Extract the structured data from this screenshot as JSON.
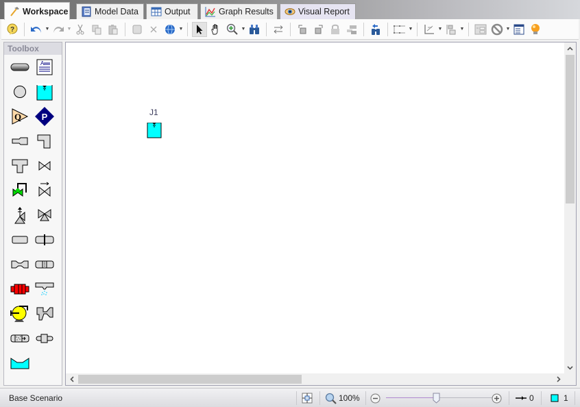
{
  "tabs": [
    {
      "label": "Workspace",
      "icon": "hammer-icon",
      "active": true
    },
    {
      "label": "Model Data",
      "icon": "notebook-icon",
      "active": false
    },
    {
      "label": "Output",
      "icon": "table-grid-icon",
      "active": false
    },
    {
      "label": "Graph Results",
      "icon": "graph-icon",
      "active": false
    },
    {
      "label": "Visual Report",
      "icon": "eye-icon",
      "active": false
    }
  ],
  "toolbar": {
    "items": [
      {
        "name": "help",
        "icon": "help-icon"
      },
      {
        "name": "undo",
        "icon": "undo-icon"
      },
      {
        "name": "redo",
        "icon": "redo-icon",
        "disabled": true
      },
      {
        "name": "cut",
        "icon": "scissors-icon",
        "disabled": true
      },
      {
        "name": "copy",
        "icon": "copy-icon",
        "disabled": true
      },
      {
        "name": "paste",
        "icon": "paste-icon",
        "disabled": true
      },
      {
        "name": "group",
        "icon": "group-icon",
        "disabled": true
      },
      {
        "name": "delete",
        "icon": "delete-x-icon",
        "disabled": true
      },
      {
        "name": "globe",
        "icon": "globe-icon"
      },
      {
        "name": "select",
        "icon": "pointer-arrow-icon",
        "selected": true
      },
      {
        "name": "pan",
        "icon": "hand-icon"
      },
      {
        "name": "zoom",
        "icon": "zoom-in-icon"
      },
      {
        "name": "find",
        "icon": "binoculars-icon"
      },
      {
        "name": "reverse",
        "icon": "reverse-direction-icon"
      },
      {
        "name": "rotate-left",
        "icon": "rotate-left-icon"
      },
      {
        "name": "rotate-right",
        "icon": "rotate-right-icon"
      },
      {
        "name": "lock",
        "icon": "lock-icon",
        "disabled": true
      },
      {
        "name": "join",
        "icon": "join-icon",
        "disabled": true
      },
      {
        "name": "find-back",
        "icon": "binoculars-back-icon"
      },
      {
        "name": "pipe-routing",
        "icon": "pipe-routing-icon"
      },
      {
        "name": "align",
        "icon": "align-icon"
      },
      {
        "name": "distribute",
        "icon": "distribute-icon"
      },
      {
        "name": "annotation",
        "icon": "annotation-icon"
      },
      {
        "name": "special-condition",
        "icon": "no-entry-icon"
      },
      {
        "name": "properties",
        "icon": "properties-list-icon"
      },
      {
        "name": "tips",
        "icon": "lightbulb-icon"
      }
    ]
  },
  "toolbox": {
    "title": "Toolbox",
    "tools": [
      {
        "name": "pipe",
        "icon": "pipe-icon"
      },
      {
        "name": "annotation",
        "icon": "text-annotation-icon"
      },
      {
        "name": "branch",
        "icon": "branch-circle-icon"
      },
      {
        "name": "reservoir",
        "icon": "reservoir-icon"
      },
      {
        "name": "assigned-flow",
        "icon": "assigned-flow-icon"
      },
      {
        "name": "assigned-pressure",
        "icon": "assigned-pressure-icon"
      },
      {
        "name": "area-change",
        "icon": "area-change-icon"
      },
      {
        "name": "bend",
        "icon": "bend-icon"
      },
      {
        "name": "tee",
        "icon": "tee-icon"
      },
      {
        "name": "valve",
        "icon": "valve-icon"
      },
      {
        "name": "control-valve",
        "icon": "control-valve-icon"
      },
      {
        "name": "check-valve",
        "icon": "check-valve-icon"
      },
      {
        "name": "relief-valve",
        "icon": "relief-valve-icon"
      },
      {
        "name": "three-way-valve",
        "icon": "three-way-valve-icon"
      },
      {
        "name": "general-component",
        "icon": "general-component-icon"
      },
      {
        "name": "orifice",
        "icon": "orifice-icon"
      },
      {
        "name": "venturi",
        "icon": "venturi-icon"
      },
      {
        "name": "screen",
        "icon": "screen-icon"
      },
      {
        "name": "heat-exchanger",
        "icon": "heat-exchanger-icon"
      },
      {
        "name": "spray-discharge",
        "icon": "spray-discharge-icon"
      },
      {
        "name": "pump",
        "icon": "pump-icon"
      },
      {
        "name": "volume-balance",
        "icon": "volume-balance-icon"
      },
      {
        "name": "filter",
        "icon": "filter-icon"
      },
      {
        "name": "dead-end",
        "icon": "dead-end-icon"
      },
      {
        "name": "open-tank",
        "icon": "open-tank-icon"
      }
    ]
  },
  "workspace": {
    "junctions": [
      {
        "label": "J1",
        "type": "reservoir",
        "color": "#00ffff"
      }
    ]
  },
  "statusbar": {
    "scenario": "Base Scenario",
    "zoom_level": "100%",
    "zoom_slider_fraction": 0.47,
    "pipe_count": "0",
    "junction_count": "1"
  },
  "colors": {
    "reservoir_fill": "#00ffff",
    "pump_fill": "#ffff00",
    "heat_exchanger_fill": "#ff0000",
    "control_valve_fill": "#00dd00",
    "assigned_pressure_fill": "#000080",
    "assigned_flow_fill": "#ffd9a8"
  }
}
